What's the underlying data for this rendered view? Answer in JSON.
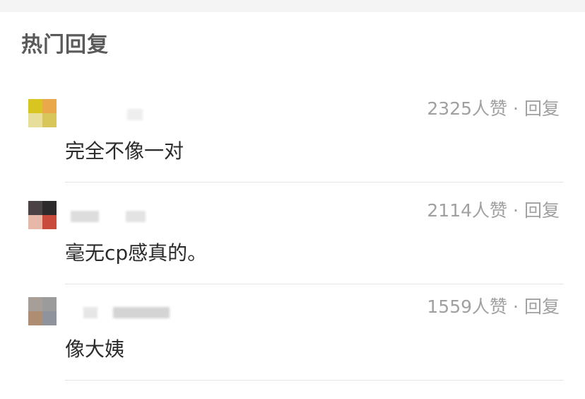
{
  "section": {
    "title": "热门回复"
  },
  "comments": [
    {
      "likes": "2325人赞",
      "separator": "·",
      "reply_label": "回复",
      "text": "完全不像一对",
      "avatar_colors": [
        "#d9c522",
        "#e9a84a",
        "#e6de9a",
        "#d8c65a"
      ]
    },
    {
      "likes": "2114人赞",
      "separator": "·",
      "reply_label": "回复",
      "text": "毫无cp感真的。",
      "avatar_colors": [
        "#4b4246",
        "#2d2a2b",
        "#e7b8a7",
        "#c84b3c"
      ]
    },
    {
      "likes": "1559人赞",
      "separator": "·",
      "reply_label": "回复",
      "text": "像大姨",
      "avatar_colors": [
        "#a79e98",
        "#9a9b9a",
        "#ae8d72",
        "#8f949b"
      ]
    }
  ]
}
